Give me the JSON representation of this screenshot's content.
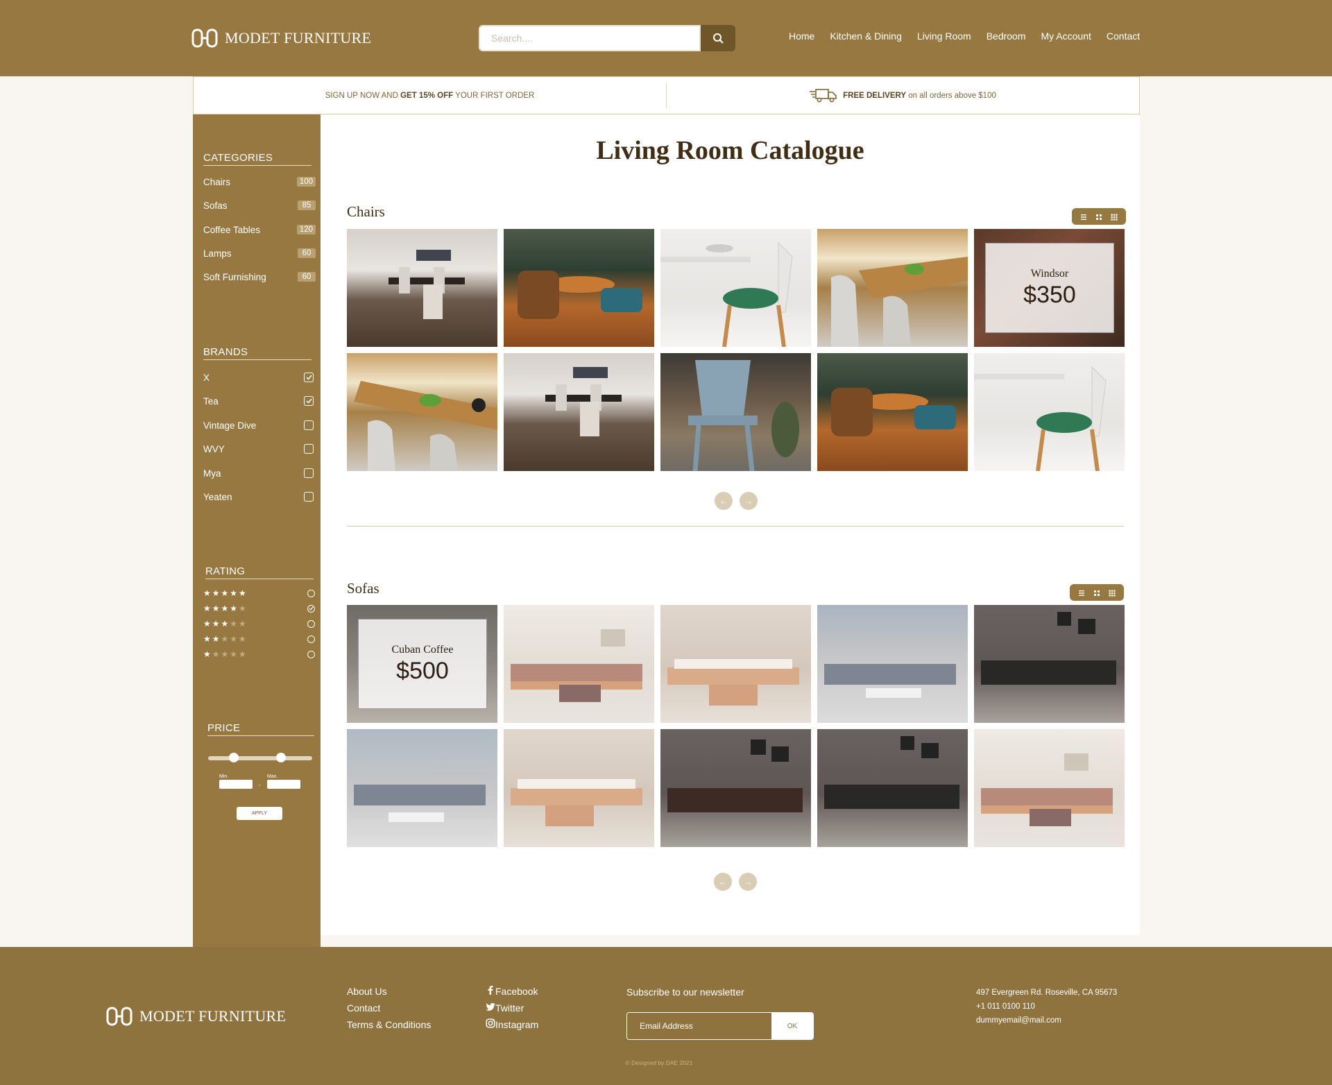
{
  "header": {
    "brand": "MODET FURNITURE",
    "search_placeholder": "Search....",
    "nav": [
      "Home",
      "Kitchen & Dining",
      "Living Room",
      "Bedroom",
      "My Account",
      "Contact"
    ]
  },
  "promo": {
    "left_pre": "SIGN UP NOW AND ",
    "left_bold": "GET 15% OFF",
    "left_post": " YOUR FIRST ORDER",
    "right_bold": "FREE DELIVERY",
    "right_post": " on all orders above $100"
  },
  "sidebar": {
    "categories_title": "CATEGORIES",
    "categories": [
      {
        "label": "Chairs",
        "count": "100"
      },
      {
        "label": "Sofas",
        "count": "85"
      },
      {
        "label": "Coffee Tables",
        "count": "120"
      },
      {
        "label": "Lamps",
        "count": "60"
      },
      {
        "label": "Soft Furnishing",
        "count": "60"
      }
    ],
    "brands_title": "BRANDS",
    "brands": [
      {
        "label": "X",
        "checked": true
      },
      {
        "label": "Tea",
        "checked": true
      },
      {
        "label": "Vintage Dive",
        "checked": false
      },
      {
        "label": "WVY",
        "checked": false
      },
      {
        "label": "Mya",
        "checked": false
      },
      {
        "label": "Yeaten",
        "checked": false
      }
    ],
    "rating_title": "RATING",
    "ratings": [
      {
        "stars": 5,
        "selected": false
      },
      {
        "stars": 4,
        "selected": true
      },
      {
        "stars": 3,
        "selected": false
      },
      {
        "stars": 2,
        "selected": false
      },
      {
        "stars": 1,
        "selected": false
      }
    ],
    "price_title": "PRICE",
    "price_slider": {
      "min_fraction": 0.22,
      "max_fraction": 0.72
    },
    "min_label": "Min.",
    "max_label": "Max.",
    "apply_label": "APPLY"
  },
  "main": {
    "title": "Living Room Catalogue",
    "chairs_title": "Chairs",
    "chairs_overlay": {
      "name": "Windsor",
      "price": "$350"
    },
    "sofas_title": "Sofas",
    "sofas_overlay": {
      "name": "Cuban Coffee",
      "price": "$500"
    },
    "prev": "←",
    "next": "→"
  },
  "footer": {
    "brand": "MODET FURNITURE",
    "links": [
      "About Us",
      "Contact",
      "Terms & Conditions"
    ],
    "social": [
      "Facebook",
      "Twitter",
      "Instagram"
    ],
    "newsletter_label": "Subscribe to our newsletter",
    "newsletter_placeholder": "Email Address",
    "ok_label": "OK",
    "address": "497 Evergreen Rd. Roseville, CA 95673",
    "phone": "+1 011 0100 110",
    "email": "dummyemail@mail.com",
    "copyright": "© Designed by DAE 2021"
  },
  "colors": {
    "brand": "#977841",
    "brand_dark": "#6e5629",
    "footer": "#8f733e",
    "text_dark": "#3f2d14"
  }
}
